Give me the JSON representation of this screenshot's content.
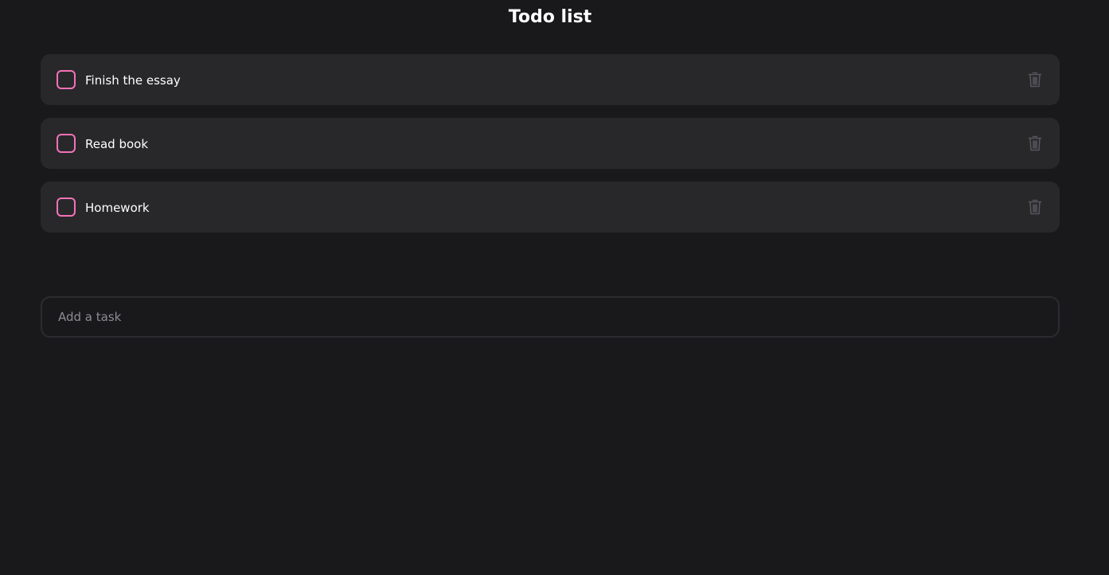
{
  "app": {
    "title": "Todo list"
  },
  "todos": [
    {
      "label": "Finish the essay",
      "completed": false
    },
    {
      "label": "Read book",
      "completed": false
    },
    {
      "label": "Homework",
      "completed": false
    }
  ],
  "add_task": {
    "placeholder": "Add a task",
    "value": ""
  },
  "icons": {
    "checkbox": "checkbox-icon",
    "delete": "trash-icon"
  },
  "colors": {
    "background": "#19191b",
    "card": "#28282b",
    "accent": "#f472b6",
    "icon_muted": "#55555c",
    "placeholder": "#8b8b93"
  }
}
